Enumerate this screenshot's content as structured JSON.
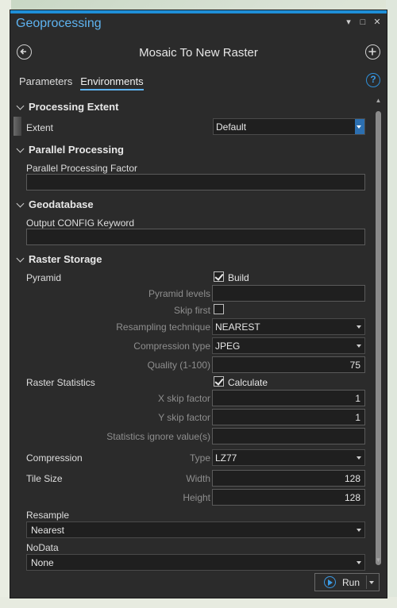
{
  "pane": {
    "title": "Geoprocessing",
    "tool_title": "Mosaic To New Raster",
    "window_controls": [
      "▾",
      "□",
      "✕"
    ]
  },
  "tabs": [
    {
      "label": "Parameters",
      "active": false
    },
    {
      "label": "Environments",
      "active": true
    }
  ],
  "help_label": "?",
  "sections": {
    "processing_extent": {
      "title": "Processing Extent",
      "extent_label": "Extent",
      "extent_value": "Default"
    },
    "parallel_processing": {
      "title": "Parallel Processing",
      "factor_label": "Parallel Processing Factor",
      "factor_value": ""
    },
    "geodatabase": {
      "title": "Geodatabase",
      "config_label": "Output CONFIG Keyword",
      "config_value": ""
    },
    "raster_storage": {
      "title": "Raster Storage",
      "pyramid_label": "Pyramid",
      "build_label": "Build",
      "build_checked": true,
      "pyramid_levels_label": "Pyramid levels",
      "pyramid_levels_value": "",
      "skip_first_label": "Skip first",
      "skip_first_checked": false,
      "resampling_label": "Resampling technique",
      "resampling_value": "NEAREST",
      "compression_type_label": "Compression type",
      "compression_type_value": "JPEG",
      "quality_label": "Quality (1-100)",
      "quality_value": "75",
      "raster_stats_label": "Raster Statistics",
      "calculate_label": "Calculate",
      "calculate_checked": true,
      "x_skip_label": "X skip factor",
      "x_skip_value": "1",
      "y_skip_label": "Y skip factor",
      "y_skip_value": "1",
      "stats_ignore_label": "Statistics ignore value(s)",
      "stats_ignore_value": "",
      "compression_label": "Compression",
      "type_label": "Type",
      "type_value": "LZ77",
      "tile_size_label": "Tile Size",
      "width_label": "Width",
      "width_value": "128",
      "height_label": "Height",
      "height_value": "128",
      "resample_label": "Resample",
      "resample_value": "Nearest",
      "nodata_label": "NoData",
      "nodata_value": "None"
    }
  },
  "run_button": {
    "label": "Run"
  },
  "colors": {
    "accent": "#1f8fd8",
    "title": "#5eb3f0",
    "panel": "#2b2b2b"
  },
  "icons": [
    "back-arrow-icon",
    "add-icon",
    "help-icon",
    "play-icon"
  ]
}
